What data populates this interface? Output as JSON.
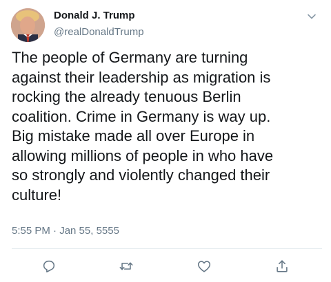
{
  "tweet": {
    "author_name": "Donald J. Trump",
    "author_handle": "@realDonaldTrump",
    "text_lines": [
      "The people of Germany are turning",
      "against their leadership as migration is",
      "rocking the already tenuous Berlin",
      "coalition. Crime in Germany is way up.",
      "Big mistake made all over Europe in",
      "allowing millions of people in who have",
      "so strongly and violently changed their",
      "culture!"
    ],
    "timestamp": "5:55 PM · Jan 55, 5555"
  },
  "icons": {
    "more": "chevron-down-icon",
    "reply": "reply-icon",
    "retweet": "retweet-icon",
    "like": "heart-icon",
    "share": "share-icon"
  },
  "colors": {
    "text": "#14171a",
    "secondary_text": "#657786",
    "divider": "#e6ecf0",
    "icon": "#657786"
  }
}
